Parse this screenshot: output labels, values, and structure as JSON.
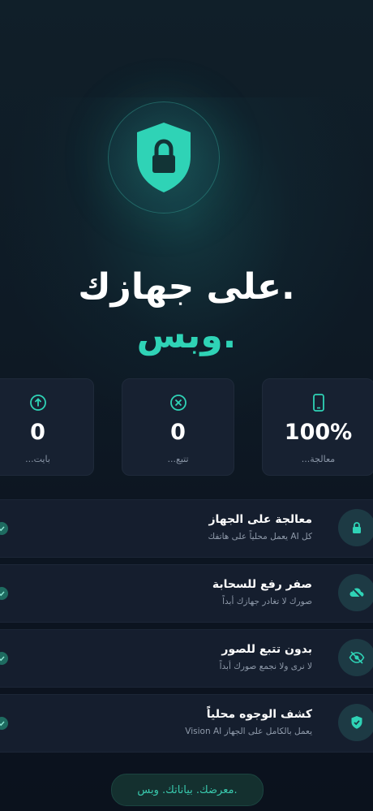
{
  "hero": {
    "line1": ".على جهازك",
    "line2": ".وبس"
  },
  "stats": [
    {
      "value": "100%",
      "label": "معالجة...",
      "icon": "phone-icon"
    },
    {
      "value": "0",
      "label": "تتبع...",
      "icon": "x-circle-icon"
    },
    {
      "value": "0",
      "label": "بايت...",
      "icon": "upload-icon"
    }
  ],
  "features": [
    {
      "title": "معالجة على الجهاز",
      "subtitle": "كل AI يعمل محلياً على هاتفك",
      "icon": "lock-icon"
    },
    {
      "title": "صفر رفع للسحابة",
      "subtitle": "صورك لا تغادر جهازك أبداً",
      "icon": "cloud-off-icon"
    },
    {
      "title": "بدون تتبع للصور",
      "subtitle": "لا نرى ولا نجمع صورك أبداً",
      "icon": "eye-off-icon"
    },
    {
      "title": "كشف الوجوه محلياً",
      "subtitle": "يعمل بالكامل على الجهاز Vision AI",
      "icon": "shield-check-icon"
    }
  ],
  "footer": {
    "text": ".معرضك. بياناتك. وبس"
  },
  "colors": {
    "accent": "#2fd3b6",
    "background": "#0e1a25",
    "card": "#172131"
  }
}
